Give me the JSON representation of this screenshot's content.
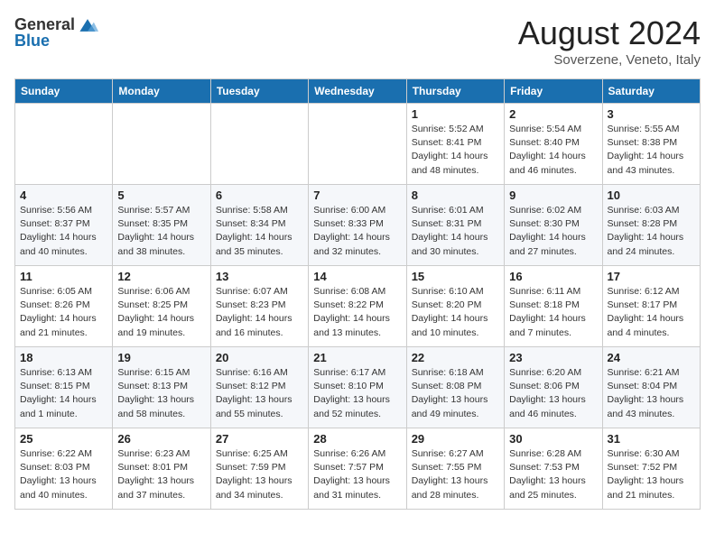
{
  "header": {
    "logo_line1": "General",
    "logo_line2": "Blue",
    "month": "August 2024",
    "location": "Soverzene, Veneto, Italy"
  },
  "days_of_week": [
    "Sunday",
    "Monday",
    "Tuesday",
    "Wednesday",
    "Thursday",
    "Friday",
    "Saturday"
  ],
  "weeks": [
    [
      {
        "day": "",
        "info": ""
      },
      {
        "day": "",
        "info": ""
      },
      {
        "day": "",
        "info": ""
      },
      {
        "day": "",
        "info": ""
      },
      {
        "day": "1",
        "info": "Sunrise: 5:52 AM\nSunset: 8:41 PM\nDaylight: 14 hours\nand 48 minutes."
      },
      {
        "day": "2",
        "info": "Sunrise: 5:54 AM\nSunset: 8:40 PM\nDaylight: 14 hours\nand 46 minutes."
      },
      {
        "day": "3",
        "info": "Sunrise: 5:55 AM\nSunset: 8:38 PM\nDaylight: 14 hours\nand 43 minutes."
      }
    ],
    [
      {
        "day": "4",
        "info": "Sunrise: 5:56 AM\nSunset: 8:37 PM\nDaylight: 14 hours\nand 40 minutes."
      },
      {
        "day": "5",
        "info": "Sunrise: 5:57 AM\nSunset: 8:35 PM\nDaylight: 14 hours\nand 38 minutes."
      },
      {
        "day": "6",
        "info": "Sunrise: 5:58 AM\nSunset: 8:34 PM\nDaylight: 14 hours\nand 35 minutes."
      },
      {
        "day": "7",
        "info": "Sunrise: 6:00 AM\nSunset: 8:33 PM\nDaylight: 14 hours\nand 32 minutes."
      },
      {
        "day": "8",
        "info": "Sunrise: 6:01 AM\nSunset: 8:31 PM\nDaylight: 14 hours\nand 30 minutes."
      },
      {
        "day": "9",
        "info": "Sunrise: 6:02 AM\nSunset: 8:30 PM\nDaylight: 14 hours\nand 27 minutes."
      },
      {
        "day": "10",
        "info": "Sunrise: 6:03 AM\nSunset: 8:28 PM\nDaylight: 14 hours\nand 24 minutes."
      }
    ],
    [
      {
        "day": "11",
        "info": "Sunrise: 6:05 AM\nSunset: 8:26 PM\nDaylight: 14 hours\nand 21 minutes."
      },
      {
        "day": "12",
        "info": "Sunrise: 6:06 AM\nSunset: 8:25 PM\nDaylight: 14 hours\nand 19 minutes."
      },
      {
        "day": "13",
        "info": "Sunrise: 6:07 AM\nSunset: 8:23 PM\nDaylight: 14 hours\nand 16 minutes."
      },
      {
        "day": "14",
        "info": "Sunrise: 6:08 AM\nSunset: 8:22 PM\nDaylight: 14 hours\nand 13 minutes."
      },
      {
        "day": "15",
        "info": "Sunrise: 6:10 AM\nSunset: 8:20 PM\nDaylight: 14 hours\nand 10 minutes."
      },
      {
        "day": "16",
        "info": "Sunrise: 6:11 AM\nSunset: 8:18 PM\nDaylight: 14 hours\nand 7 minutes."
      },
      {
        "day": "17",
        "info": "Sunrise: 6:12 AM\nSunset: 8:17 PM\nDaylight: 14 hours\nand 4 minutes."
      }
    ],
    [
      {
        "day": "18",
        "info": "Sunrise: 6:13 AM\nSunset: 8:15 PM\nDaylight: 14 hours\nand 1 minute."
      },
      {
        "day": "19",
        "info": "Sunrise: 6:15 AM\nSunset: 8:13 PM\nDaylight: 13 hours\nand 58 minutes."
      },
      {
        "day": "20",
        "info": "Sunrise: 6:16 AM\nSunset: 8:12 PM\nDaylight: 13 hours\nand 55 minutes."
      },
      {
        "day": "21",
        "info": "Sunrise: 6:17 AM\nSunset: 8:10 PM\nDaylight: 13 hours\nand 52 minutes."
      },
      {
        "day": "22",
        "info": "Sunrise: 6:18 AM\nSunset: 8:08 PM\nDaylight: 13 hours\nand 49 minutes."
      },
      {
        "day": "23",
        "info": "Sunrise: 6:20 AM\nSunset: 8:06 PM\nDaylight: 13 hours\nand 46 minutes."
      },
      {
        "day": "24",
        "info": "Sunrise: 6:21 AM\nSunset: 8:04 PM\nDaylight: 13 hours\nand 43 minutes."
      }
    ],
    [
      {
        "day": "25",
        "info": "Sunrise: 6:22 AM\nSunset: 8:03 PM\nDaylight: 13 hours\nand 40 minutes."
      },
      {
        "day": "26",
        "info": "Sunrise: 6:23 AM\nSunset: 8:01 PM\nDaylight: 13 hours\nand 37 minutes."
      },
      {
        "day": "27",
        "info": "Sunrise: 6:25 AM\nSunset: 7:59 PM\nDaylight: 13 hours\nand 34 minutes."
      },
      {
        "day": "28",
        "info": "Sunrise: 6:26 AM\nSunset: 7:57 PM\nDaylight: 13 hours\nand 31 minutes."
      },
      {
        "day": "29",
        "info": "Sunrise: 6:27 AM\nSunset: 7:55 PM\nDaylight: 13 hours\nand 28 minutes."
      },
      {
        "day": "30",
        "info": "Sunrise: 6:28 AM\nSunset: 7:53 PM\nDaylight: 13 hours\nand 25 minutes."
      },
      {
        "day": "31",
        "info": "Sunrise: 6:30 AM\nSunset: 7:52 PM\nDaylight: 13 hours\nand 21 minutes."
      }
    ]
  ]
}
